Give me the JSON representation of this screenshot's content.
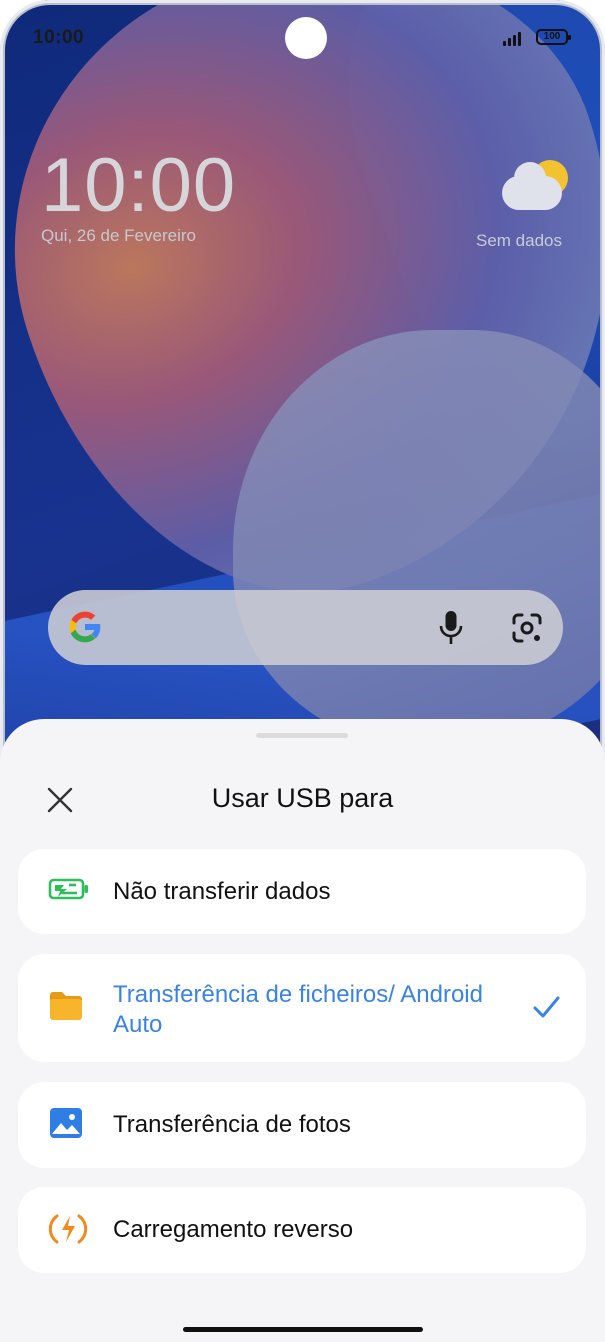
{
  "status_bar": {
    "time": "10:00",
    "battery": "100",
    "signal_icon": "signal-icon"
  },
  "lock_screen": {
    "clock": "10:00",
    "date": "Qui, 26 de Fevereiro",
    "weather": {
      "icon": "partly-cloudy-icon",
      "text": "Sem dados"
    }
  },
  "search_bar": {
    "logo": "google-g-icon",
    "voice_icon": "microphone-icon",
    "lens_icon": "lens-camera-icon"
  },
  "usb_sheet": {
    "title": "Usar USB para",
    "close_icon": "close-icon",
    "options": [
      {
        "label": "Não transferir dados",
        "icon": "battery-charging-icon",
        "selected": false
      },
      {
        "label": "Transferência de ficheiros/ Android Auto",
        "icon": "folder-icon",
        "selected": true
      },
      {
        "label": "Transferência de fotos",
        "icon": "image-icon",
        "selected": false
      },
      {
        "label": "Carregamento reverso",
        "icon": "reverse-charging-icon",
        "selected": false
      }
    ],
    "selected_icon": "checkmark-icon"
  },
  "colors": {
    "accent": "#3a83e6",
    "battery_green": "#2fbf5a",
    "folder_yellow": "#f6b52a",
    "image_blue": "#2f7ee6",
    "reverse_orange": "#f08a1c"
  }
}
